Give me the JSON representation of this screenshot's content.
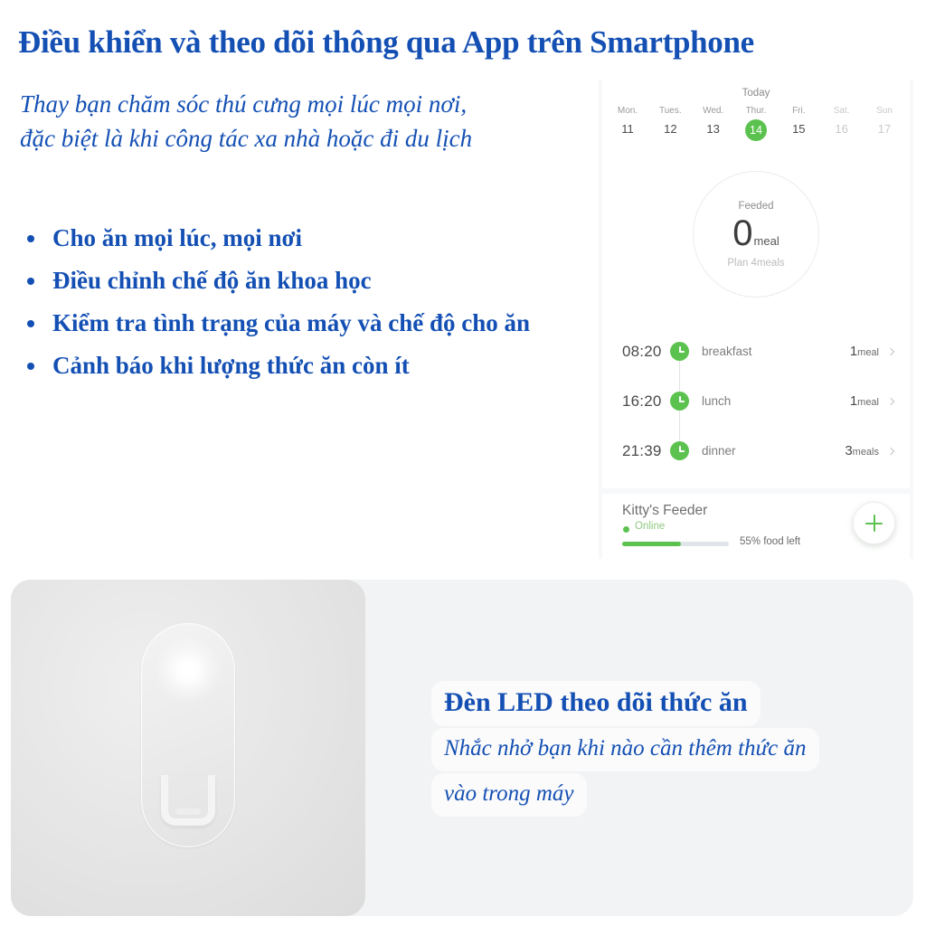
{
  "headline": "Điều khiển và theo dõi thông qua App trên Smartphone",
  "subheadline": [
    "Thay bạn chăm sóc thú cưng mọi lúc mọi nơi,",
    "đặc biệt là khi công tác xa nhà hoặc đi du lịch"
  ],
  "bullets": [
    "Cho ăn mọi lúc, mọi nơi",
    "Điều chỉnh chế độ ăn khoa học",
    "Kiểm tra tình trạng của máy và chế độ cho ăn",
    "Cảnh báo khi lượng thức ăn còn ít"
  ],
  "app": {
    "today_label": "Today",
    "week": [
      {
        "name": "Mon.",
        "date": "11",
        "state": "normal"
      },
      {
        "name": "Tues.",
        "date": "12",
        "state": "normal"
      },
      {
        "name": "Wed.",
        "date": "13",
        "state": "normal"
      },
      {
        "name": "Thur.",
        "date": "14",
        "state": "today"
      },
      {
        "name": "Fri.",
        "date": "15",
        "state": "normal"
      },
      {
        "name": "Sat.",
        "date": "16",
        "state": "dim"
      },
      {
        "name": "Sun",
        "date": "17",
        "state": "dim"
      }
    ],
    "dial": {
      "title": "Feeded",
      "value": "0",
      "unit": "meal",
      "plan": "Plan 4meals"
    },
    "schedule": [
      {
        "time": "08:20",
        "name": "breakfast",
        "amount": "1",
        "amount_unit": "meal"
      },
      {
        "time": "16:20",
        "name": "lunch",
        "amount": "1",
        "amount_unit": "meal"
      },
      {
        "time": "21:39",
        "name": "dinner",
        "amount": "3",
        "amount_unit": "meals"
      }
    ],
    "feeder": {
      "name": "Kitty's Feeder",
      "status": "Online",
      "food_left_percent": 55,
      "food_left_label": "55% food left"
    }
  },
  "lower": {
    "title": "Đèn LED theo dõi thức ăn",
    "subtitle": [
      "Nhắc nhở bạn khi nào cần thêm thức ăn",
      "vào trong máy"
    ]
  },
  "colors": {
    "brand_blue": "#1450b4",
    "accent_green": "#5cc24f",
    "panel_gray": "#f2f3f4"
  }
}
